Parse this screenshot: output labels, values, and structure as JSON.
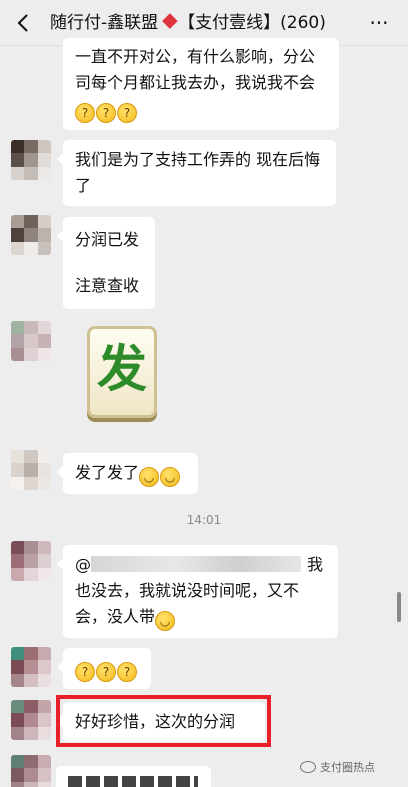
{
  "header": {
    "back_icon": "chevron-left-icon",
    "title_part1": "随行付-鑫联盟",
    "title_icon": "red-diamond-icon",
    "title_part2": "【支付壹线】(260)",
    "more_icon": "more-dots-icon",
    "more_label": "···"
  },
  "messages": [
    {
      "text_line1": "一直不开对公，有什么影响，分公",
      "text_line2": "司每个月都让我去办，我说我不会",
      "emoji": "thinking-face-emoji x3"
    },
    {
      "text_line1": "我们是为了支持工作弄的 现在后悔",
      "text_line2": "了"
    },
    {
      "text_line1": "分润已发",
      "text_line2": "注意查收"
    },
    {
      "sticker": "发",
      "sticker_icon": "mahjong-fa-tile-sticker"
    },
    {
      "text": "发了发了",
      "emoji": "grinning-face-emoji x2"
    },
    {
      "mention_prefix": "@",
      "mention_tail": "我",
      "text_line2": "也没去，我就说没时间呢，又不",
      "text_line3": "会，没人带"
    },
    {
      "emoji": "thinking-face-emoji x3"
    },
    {
      "text": "好好珍惜，这次的分润"
    }
  ],
  "time_divider": "14:01",
  "watermark": "支付圈热点",
  "colors": {
    "highlight": "#e8202a",
    "background": "#ededed",
    "bubble": "#ffffff"
  }
}
